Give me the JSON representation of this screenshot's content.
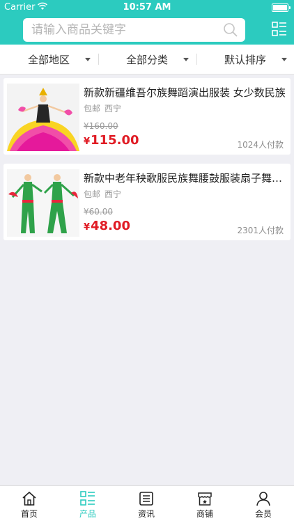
{
  "status": {
    "carrier": "Carrier",
    "time": "10:57 AM"
  },
  "search": {
    "placeholder": "请输入商品关键字"
  },
  "filters": [
    {
      "label": "全部地区"
    },
    {
      "label": "全部分类"
    },
    {
      "label": "默认排序"
    }
  ],
  "products": [
    {
      "title": "新款新疆维吾尔族舞蹈演出服装 女少数民族",
      "shipping": "包邮",
      "location": "西宁",
      "original_price": "¥160.00",
      "currency": "¥",
      "price": "115.00",
      "sold": "1024人付款"
    },
    {
      "title": "新款中老年秧歌服民族舞腰鼓服装扇子舞演出服",
      "shipping": "包邮",
      "location": "西宁",
      "original_price": "¥60.00",
      "currency": "¥",
      "price": "48.00",
      "sold": "2301人付款"
    }
  ],
  "tabs": [
    {
      "label": "首页",
      "icon": "home-icon"
    },
    {
      "label": "产品",
      "icon": "list-icon",
      "active": true
    },
    {
      "label": "资讯",
      "icon": "news-icon"
    },
    {
      "label": "商铺",
      "icon": "shop-icon"
    },
    {
      "label": "会员",
      "icon": "user-icon"
    }
  ],
  "colors": {
    "accent": "#2ccbbf",
    "price": "#e01b24"
  }
}
